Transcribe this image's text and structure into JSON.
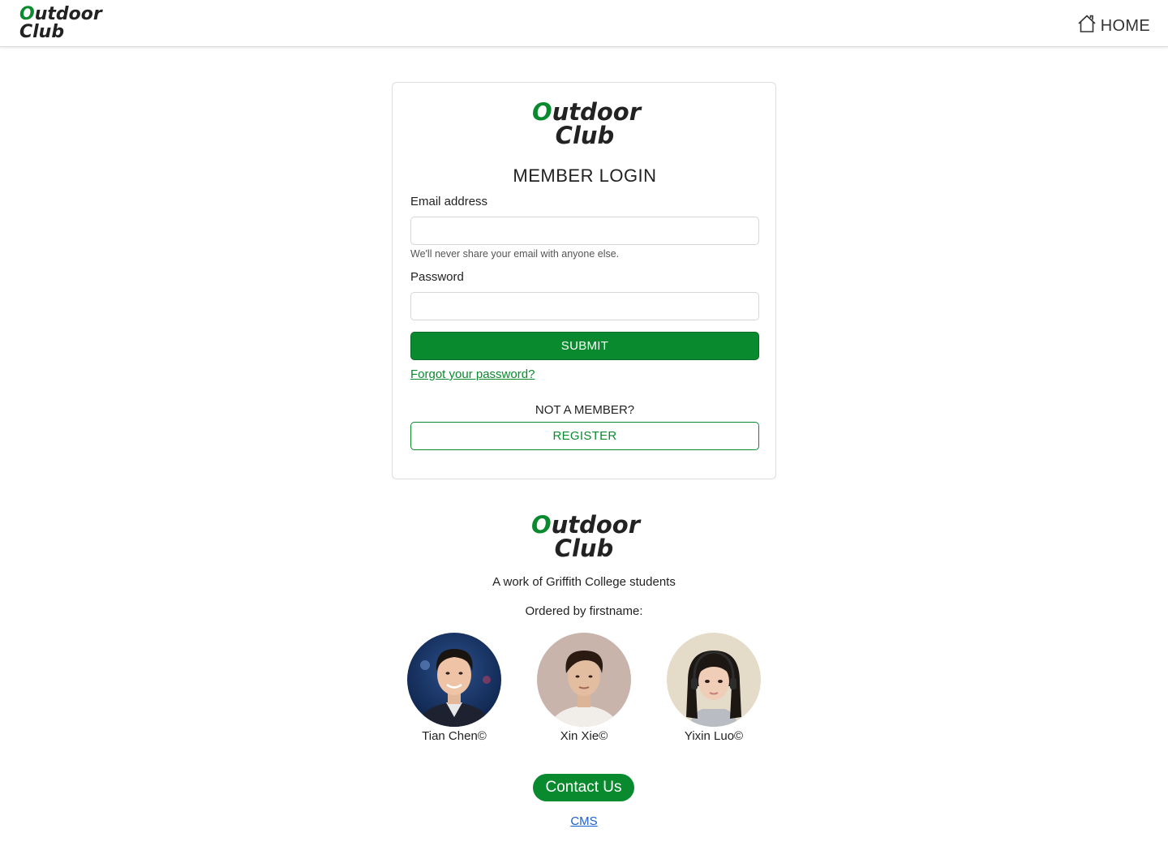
{
  "nav": {
    "logo_line1_first": "O",
    "logo_line1_rest": "utdoor",
    "logo_line2": "Club",
    "home_label": "HOME"
  },
  "login": {
    "logo_line1_first": "O",
    "logo_line1_rest": "utdoor",
    "logo_line2": "Club",
    "title": "MEMBER LOGIN",
    "email_label": "Email address",
    "email_value": "",
    "email_hint": "We'll never share your email with anyone else.",
    "password_label": "Password",
    "password_value": "",
    "submit_label": "SUBMIT",
    "forgot_label": "Forgot your password?",
    "not_member_label": "NOT A MEMBER?",
    "register_label": "REGISTER"
  },
  "footer": {
    "logo_line1_first": "O",
    "logo_line1_rest": "utdoor",
    "logo_line2": "Club",
    "credit": "A work of Griffith College students",
    "ordered_label": "Ordered by firstname:",
    "members": [
      {
        "name": "Tian Chen©"
      },
      {
        "name": "Xin Xie©"
      },
      {
        "name": "Yixin Luo©"
      }
    ],
    "contact_label": "Contact Us",
    "cms_label": "CMS"
  },
  "colors": {
    "brand_green": "#0a8a2e",
    "link_blue": "#1a5fd0"
  },
  "icons": {
    "home": "home-icon"
  }
}
